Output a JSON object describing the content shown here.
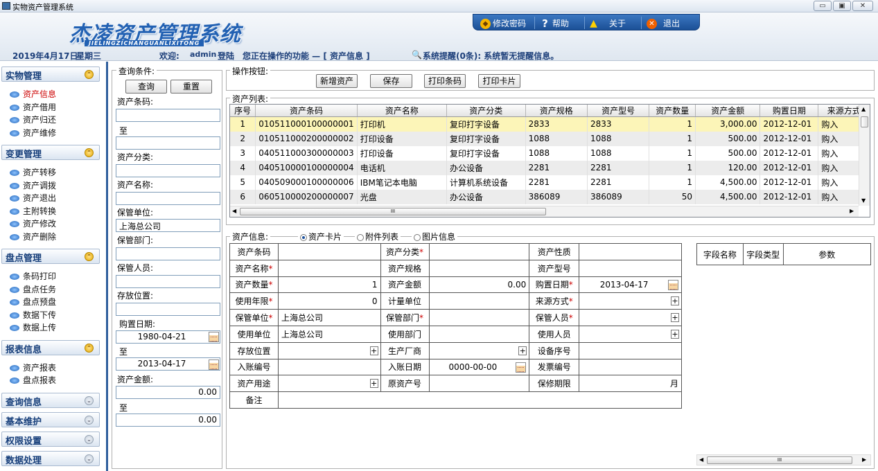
{
  "window": {
    "title": "实物资产管理系统"
  },
  "banner": {
    "logo": "杰凌资产管理系统",
    "logo_sub": "JIELINGZICHANGUANLIXITONG"
  },
  "topnav": {
    "change_pwd": "修改密码",
    "help": "帮助",
    "about": "关于",
    "exit": "退出"
  },
  "status": {
    "date": "2019年4月17日",
    "weekday": "星期三",
    "welcome": "欢迎:",
    "user": "admin",
    "login": "登陆",
    "current_label": "您正在操作的功能 — [ 资产信息 ]",
    "reminder": "系统提醒(0条): 系统暂无提醒信息。"
  },
  "sidebar": {
    "sections": [
      {
        "title": "实物管理",
        "items": [
          "资产信息",
          "资产借用",
          "资产归还",
          "资产维修"
        ]
      },
      {
        "title": "变更管理",
        "items": [
          "资产转移",
          "资产调拨",
          "资产退出",
          "主附转换",
          "资产修改",
          "资产删除"
        ]
      },
      {
        "title": "盘点管理",
        "items": [
          "条码打印",
          "盘点任务",
          "盘点预盘",
          "数据下传",
          "数据上传"
        ]
      },
      {
        "title": "报表信息",
        "items": [
          "资产报表",
          "盘点报表"
        ]
      },
      {
        "title": "查询信息",
        "items": []
      },
      {
        "title": "基本维护",
        "items": []
      },
      {
        "title": "权限设置",
        "items": []
      },
      {
        "title": "数据处理",
        "items": []
      }
    ]
  },
  "query": {
    "legend": "查询条件:",
    "search_btn": "查询",
    "reset_btn": "重置",
    "barcode_label": "资产条码:",
    "to": "至",
    "category_label": "资产分类:",
    "name_label": "资产名称:",
    "custody_unit_label": "保管单位:",
    "custody_unit_value": "上海总公司",
    "custody_dept_label": "保管部门:",
    "custodian_label": "保管人员:",
    "location_label": "存放位置:",
    "purchase_date_label": "购置日期:",
    "date_from": "1980-04-21",
    "date_to": "2013-04-17",
    "amount_label": "资产金额:",
    "amount_from": "0.00",
    "amount_to": "0.00"
  },
  "ops": {
    "legend": "操作按钮:",
    "add": "新增资产",
    "save": "保存",
    "print_barcode": "打印条码",
    "print_card": "打印卡片"
  },
  "list": {
    "legend": "资产列表:",
    "columns": [
      "序号",
      "资产条码",
      "资产名称",
      "资产分类",
      "资产规格",
      "资产型号",
      "资产数量",
      "资产金额",
      "购置日期",
      "来源方式"
    ],
    "rows": [
      [
        "1",
        "010511000100000001",
        "打印机",
        "复印打字设备",
        "2833",
        "2833",
        "1",
        "3,000.00",
        "2012-12-01",
        "购入"
      ],
      [
        "2",
        "010511000200000002",
        "打印设备",
        "复印打字设备",
        "1088",
        "1088",
        "1",
        "500.00",
        "2012-12-01",
        "购入"
      ],
      [
        "3",
        "040511000300000003",
        "打印设备",
        "复印打字设备",
        "1088",
        "1088",
        "1",
        "500.00",
        "2012-12-01",
        "购入"
      ],
      [
        "4",
        "040510000100000004",
        "电话机",
        "办公设备",
        "2281",
        "2281",
        "1",
        "120.00",
        "2012-12-01",
        "购入"
      ],
      [
        "5",
        "040509000100000006",
        "IBM笔记本电脑",
        "计算机系统设备",
        "2281",
        "2281",
        "1",
        "4,500.00",
        "2012-12-01",
        "购入"
      ],
      [
        "6",
        "060510000200000007",
        "光盘",
        "办公设备",
        "386089",
        "386089",
        "50",
        "4,500.00",
        "2012-12-01",
        "购入"
      ]
    ]
  },
  "info": {
    "legend": "资产信息:",
    "tabs": [
      "资产卡片",
      "附件列表",
      "图片信息"
    ],
    "rows": [
      [
        {
          "l": "资产条码",
          "r": false,
          "v": ""
        },
        {
          "l": "资产分类",
          "r": true,
          "v": ""
        },
        {
          "l": "资产性质",
          "r": false,
          "v": ""
        }
      ],
      [
        {
          "l": "资产名称",
          "r": true,
          "v": ""
        },
        {
          "l": "资产规格",
          "r": false,
          "v": ""
        },
        {
          "l": "资产型号",
          "r": false,
          "v": ""
        }
      ],
      [
        {
          "l": "资产数量",
          "r": true,
          "v": "1"
        },
        {
          "l": "资产金额",
          "r": false,
          "v": "0.00"
        },
        {
          "l": "购置日期",
          "r": true,
          "v": "2013-04-17"
        }
      ],
      [
        {
          "l": "使用年限",
          "r": true,
          "v": "0"
        },
        {
          "l": "计量单位",
          "r": false,
          "v": ""
        },
        {
          "l": "来源方式",
          "r": true,
          "v": ""
        }
      ],
      [
        {
          "l": "保管单位",
          "r": true,
          "v": "上海总公司"
        },
        {
          "l": "保管部门",
          "r": true,
          "v": ""
        },
        {
          "l": "保管人员",
          "r": true,
          "v": ""
        }
      ],
      [
        {
          "l": "使用单位",
          "r": false,
          "v": "上海总公司"
        },
        {
          "l": "使用部门",
          "r": false,
          "v": ""
        },
        {
          "l": "使用人员",
          "r": false,
          "v": ""
        }
      ],
      [
        {
          "l": "存放位置",
          "r": false,
          "v": ""
        },
        {
          "l": "生产厂商",
          "r": false,
          "v": ""
        },
        {
          "l": "设备序号",
          "r": false,
          "v": ""
        }
      ],
      [
        {
          "l": "入账编号",
          "r": false,
          "v": ""
        },
        {
          "l": "入账日期",
          "r": false,
          "v": "0000-00-00"
        },
        {
          "l": "发票编号",
          "r": false,
          "v": ""
        }
      ],
      [
        {
          "l": "资产用途",
          "r": false,
          "v": ""
        },
        {
          "l": "原资产号",
          "r": false,
          "v": ""
        },
        {
          "l": "保修期限",
          "r": false,
          "v": "月"
        }
      ]
    ],
    "remark_label": "备注",
    "field_table_headers": [
      "字段名称",
      "字段类型",
      "参数"
    ]
  },
  "colors": {
    "accent": "#2261b3",
    "selected_row": "#fcf5b8",
    "required": "#cc0000"
  }
}
